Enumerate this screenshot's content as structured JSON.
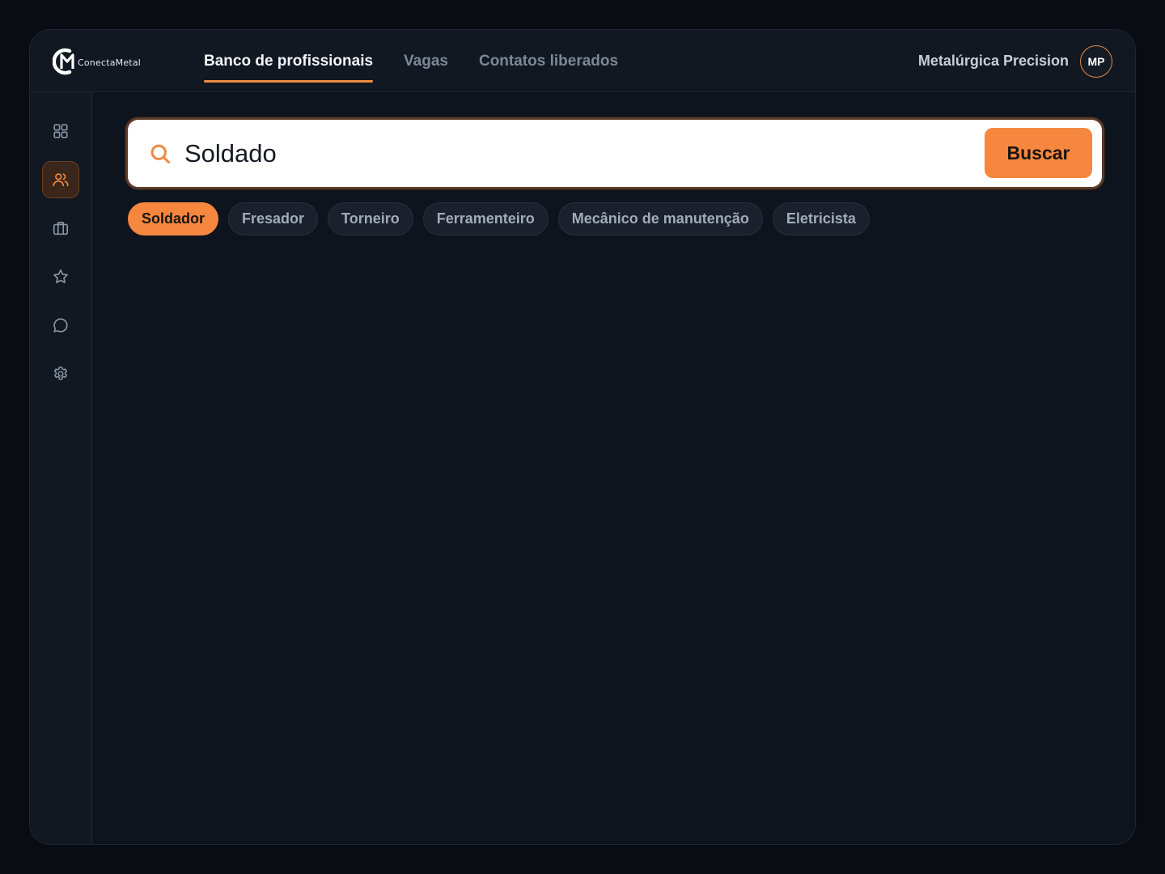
{
  "app": {
    "logo_text": "ConectaMetal",
    "logo_icon": "cm-logo-icon"
  },
  "nav": {
    "items": [
      {
        "label": "Banco de profissionais",
        "active": true
      },
      {
        "label": "Vagas",
        "active": false
      },
      {
        "label": "Contatos liberados",
        "active": false
      }
    ]
  },
  "user": {
    "company": "Metalúrgica Precision",
    "initials": "MP"
  },
  "sidebar": {
    "items": [
      {
        "icon": "grid-icon",
        "active": false
      },
      {
        "icon": "users-icon",
        "active": true
      },
      {
        "icon": "briefcase-icon",
        "active": false
      },
      {
        "icon": "star-icon",
        "active": false
      },
      {
        "icon": "chat-icon",
        "active": false
      },
      {
        "icon": "settings-icon",
        "active": false
      }
    ]
  },
  "search": {
    "value": "Soldado",
    "button_label": "Buscar"
  },
  "chips": [
    {
      "label": "Soldador",
      "active": true
    },
    {
      "label": "Fresador",
      "active": false
    },
    {
      "label": "Torneiro",
      "active": false
    },
    {
      "label": "Ferramenteiro",
      "active": false
    },
    {
      "label": "Mecânico de manutenção",
      "active": false
    },
    {
      "label": "Eletricista",
      "active": false
    }
  ],
  "colors": {
    "accent": "#f5873f",
    "background": "#0e141d",
    "panel": "#111821"
  }
}
